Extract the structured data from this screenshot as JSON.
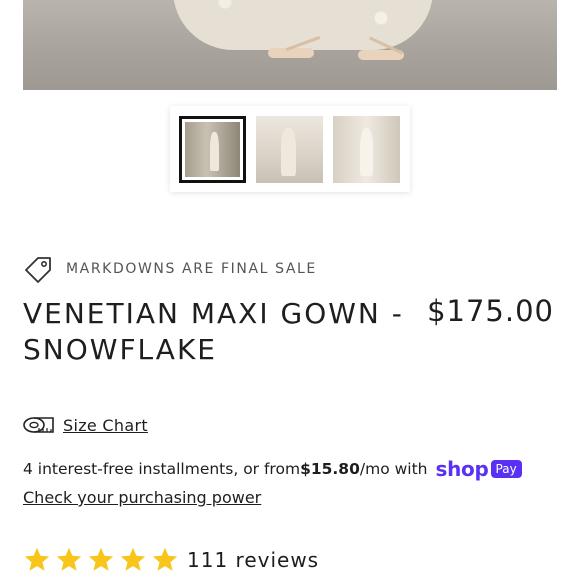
{
  "sale_notice": "MARKDOWNS ARE FINAL SALE",
  "product": {
    "title": "VENETIAN MAXI GOWN - SNOWFLAKE",
    "price": "$175.00"
  },
  "size_chart": {
    "label": "Size Chart",
    "icon": "measuring-tape-icon"
  },
  "installments": {
    "prefix": "4 interest-free installments, or from ",
    "amount": "$15.80",
    "suffix": "/mo with",
    "brand": "shop",
    "badge": "Pay",
    "link": "Check your purchasing power",
    "brand_color": "#5a31f4"
  },
  "reviews": {
    "rating": 5,
    "max": 5,
    "label": "111 reviews",
    "star_color": "#f7c51b"
  },
  "gallery": {
    "thumbnails": 3,
    "selected_index": 0
  }
}
